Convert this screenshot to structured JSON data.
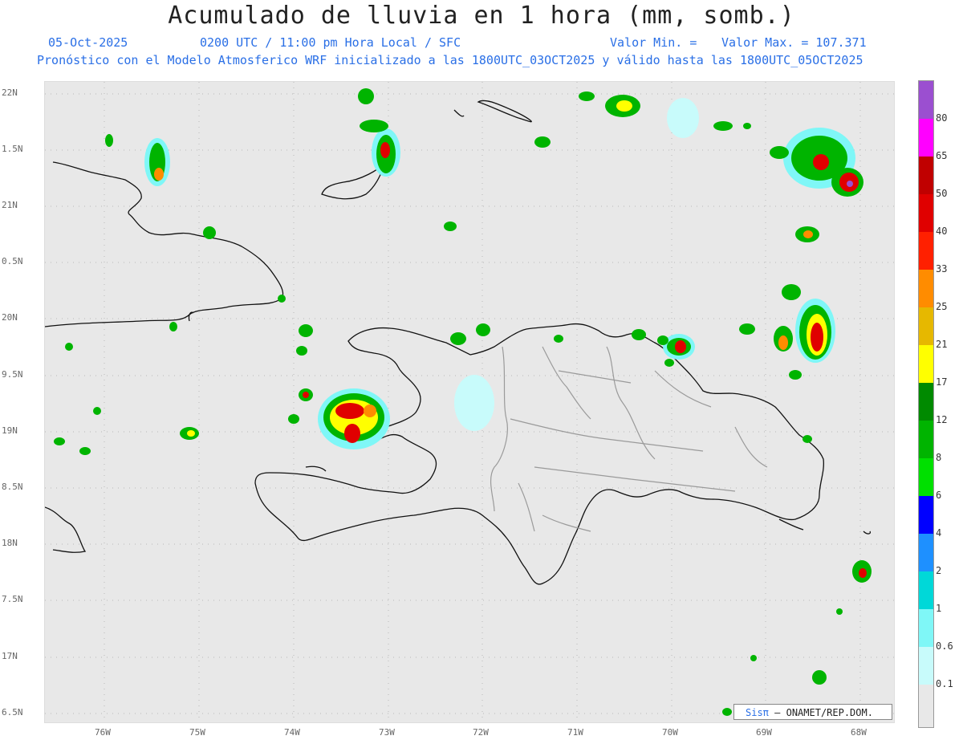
{
  "header": {
    "title": "Acumulado de lluvia en 1 hora (mm, somb.)",
    "date": "05-Oct-2025",
    "time": "0200 UTC / 11:00 pm Hora Local / SFC",
    "vmin": "Valor Min. =",
    "vmax": "Valor Max. = 107.371",
    "subtitle": "Pronóstico con el Modelo Atmosferico WRF inicializado a las 1800UTC_03OCT2025 y válido hasta las  1800UTC_05OCT2025"
  },
  "axes": {
    "lat_labels": [
      "22N",
      "1.5N",
      "21N",
      "0.5N",
      "20N",
      "9.5N",
      "19N",
      "8.5N",
      "18N",
      "7.5N",
      "17N",
      "6.5N"
    ],
    "lon_labels": [
      "76W",
      "75W",
      "74W",
      "73W",
      "72W",
      "71W",
      "70W",
      "69W",
      "68W"
    ]
  },
  "colorbar": {
    "labels": [
      "80",
      "65",
      "50",
      "40",
      "33",
      "25",
      "21",
      "17",
      "12",
      "8",
      "6",
      "4",
      "2",
      "1",
      "0.6",
      "0.1"
    ],
    "colors": [
      "#9b4fd0",
      "#ff00ff",
      "#c00000",
      "#e00000",
      "#ff2000",
      "#ff8c00",
      "#e6b800",
      "#ffff00",
      "#008a00",
      "#00b400",
      "#00e000",
      "#0000ff",
      "#1e90ff",
      "#00d8d8",
      "#7ff7f7",
      "#c8fbfb",
      "#e8e8e8"
    ]
  },
  "credit": {
    "brand": "Sisπ",
    "text": "– ONAMET/REP.DOM."
  }
}
